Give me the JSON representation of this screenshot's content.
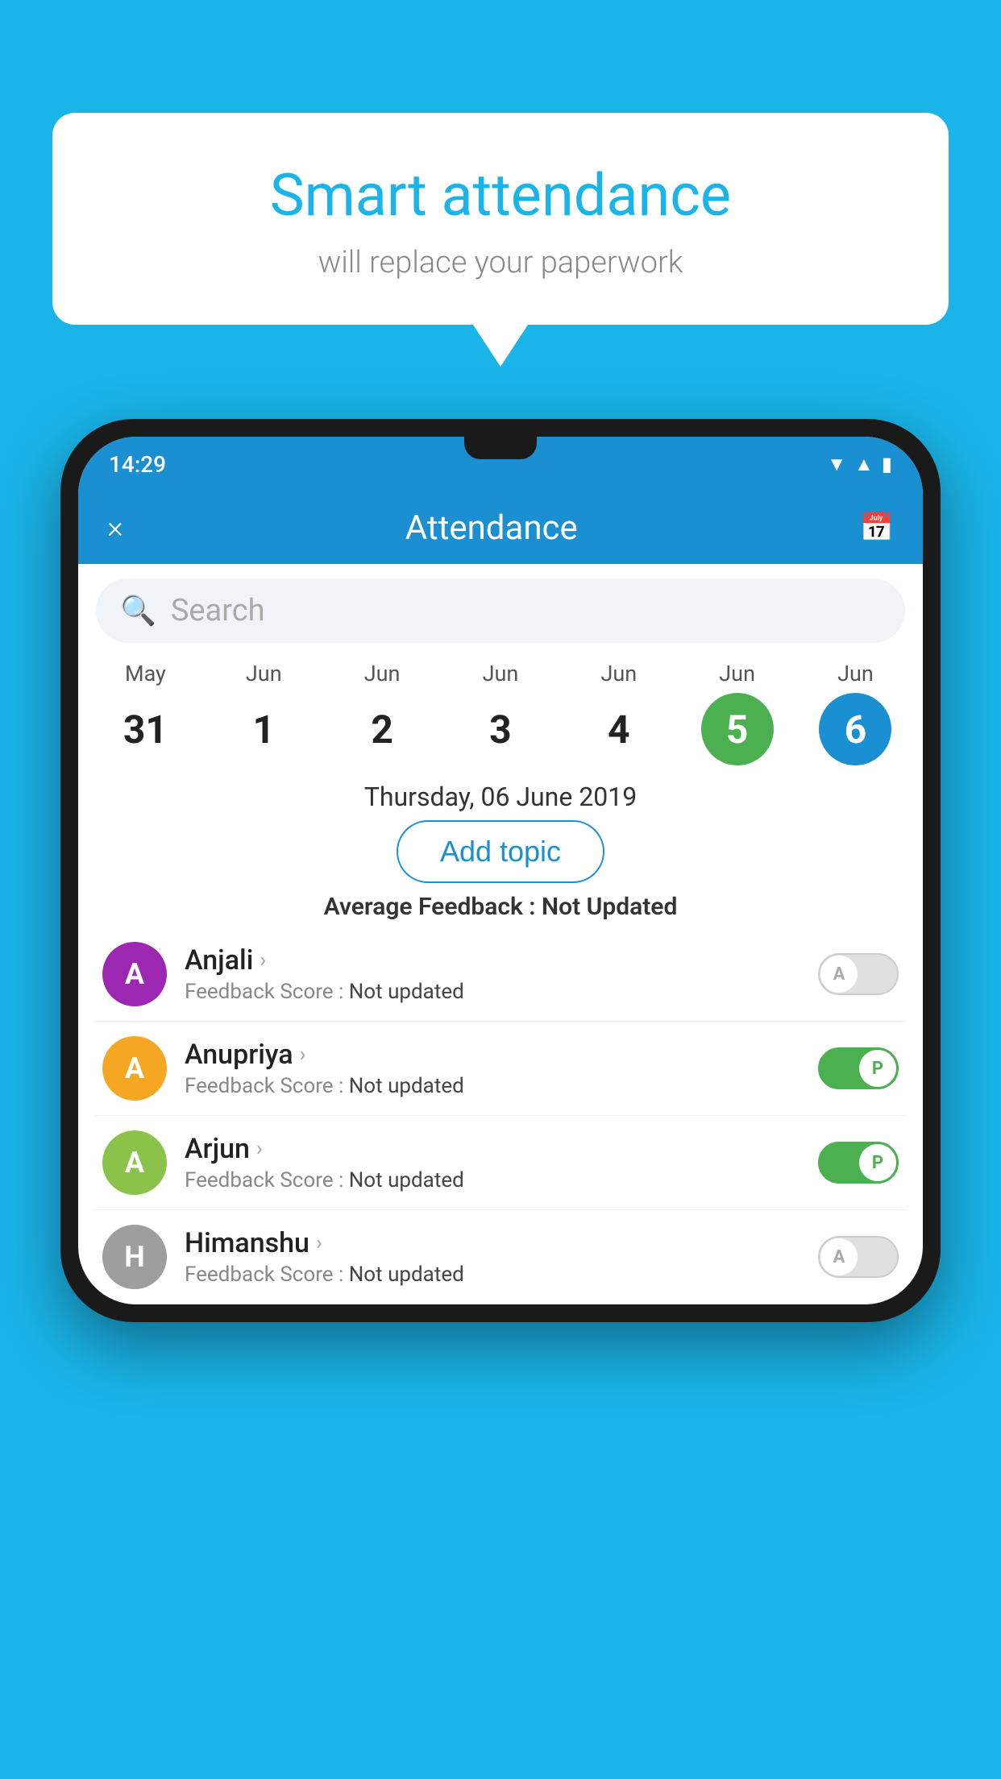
{
  "background_color": "#1ab4e8",
  "speech_bubble": {
    "title": "Smart attendance",
    "subtitle": "will replace your paperwork"
  },
  "phone": {
    "status_bar": {
      "time": "14:29",
      "icons": [
        "wifi",
        "signal",
        "battery"
      ]
    },
    "header": {
      "title": "Attendance",
      "close_label": "×",
      "calendar_icon": "📅"
    },
    "search": {
      "placeholder": "Search"
    },
    "calendar": {
      "dates": [
        {
          "month": "May",
          "day": "31",
          "style": "normal"
        },
        {
          "month": "Jun",
          "day": "1",
          "style": "normal"
        },
        {
          "month": "Jun",
          "day": "2",
          "style": "normal"
        },
        {
          "month": "Jun",
          "day": "3",
          "style": "normal"
        },
        {
          "month": "Jun",
          "day": "4",
          "style": "normal"
        },
        {
          "month": "Jun",
          "day": "5",
          "style": "today"
        },
        {
          "month": "Jun",
          "day": "6",
          "style": "selected"
        }
      ]
    },
    "selected_date": "Thursday, 06 June 2019",
    "add_topic_label": "Add topic",
    "avg_feedback_label": "Average Feedback :",
    "avg_feedback_value": "Not Updated",
    "students": [
      {
        "name": "Anjali",
        "avatar_letter": "A",
        "avatar_color": "#9c27b0",
        "feedback_label": "Feedback Score :",
        "feedback_value": "Not updated",
        "toggle": "off",
        "toggle_letter": "A"
      },
      {
        "name": "Anupriya",
        "avatar_letter": "A",
        "avatar_color": "#f5a623",
        "feedback_label": "Feedback Score :",
        "feedback_value": "Not updated",
        "toggle": "on",
        "toggle_letter": "P"
      },
      {
        "name": "Arjun",
        "avatar_letter": "A",
        "avatar_color": "#8bc34a",
        "feedback_label": "Feedback Score :",
        "feedback_value": "Not updated",
        "toggle": "on",
        "toggle_letter": "P"
      },
      {
        "name": "Himanshu",
        "avatar_letter": "H",
        "avatar_color": "#9e9e9e",
        "feedback_label": "Feedback Score :",
        "feedback_value": "Not updated",
        "toggle": "off",
        "toggle_letter": "A"
      }
    ]
  }
}
